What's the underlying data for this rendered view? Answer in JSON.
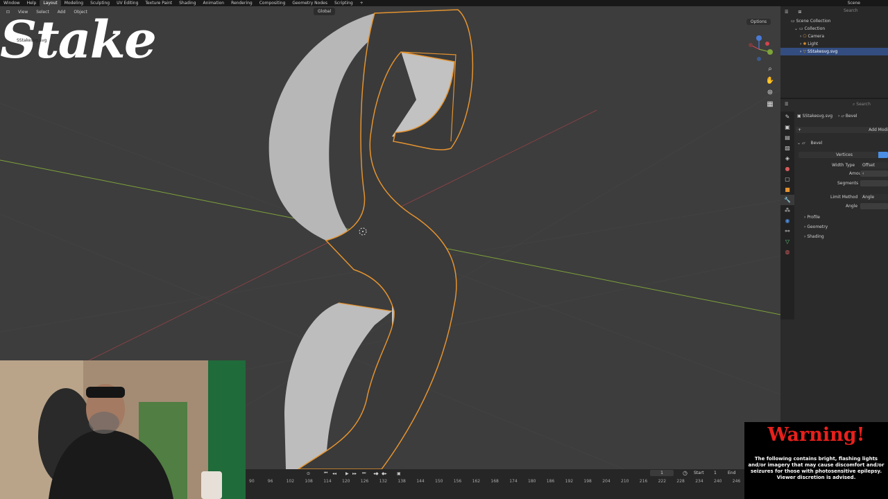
{
  "top_menu": {
    "items": [
      "Window",
      "Help",
      "Layout",
      "Modeling",
      "Sculpting",
      "UV Editing",
      "Texture Paint",
      "Shading",
      "Animation",
      "Rendering",
      "Compositing",
      "Geometry Nodes",
      "Scripting",
      "+"
    ],
    "active": "Layout",
    "scene": "Scene"
  },
  "viewport": {
    "menu": [
      "View",
      "Select",
      "Add",
      "Object"
    ],
    "orientation": "Global",
    "options_label": "Options",
    "logo_text": "Stake",
    "logo_file": "SStakesvg.svg",
    "accent_color": "#e5932f",
    "axis_x_color": "#d0444e",
    "axis_y_color": "#7ea33a"
  },
  "outliner": {
    "search_placeholder": "Search",
    "root": "Scene Collection",
    "collection": "Collection",
    "items": [
      {
        "name": "Camera",
        "icon": "camera-icon",
        "selected": false
      },
      {
        "name": "Light",
        "icon": "light-icon",
        "selected": false
      },
      {
        "name": "SStakesvg.svg",
        "icon": "object-icon",
        "selected": true
      }
    ]
  },
  "properties": {
    "search_placeholder": "Search",
    "object_name": "SStakesvg.svg",
    "modifier_name": "Bevel",
    "add_modifier_label": "Add Modi",
    "panel_title": "Bevel",
    "affect_label": "Vertices",
    "width_type_label": "Width Type",
    "width_type_value": "Offset",
    "amount_label": "Amount",
    "amount_value": "‹",
    "segments_label": "Segments",
    "limit_method_label": "Limit Method",
    "limit_method_value": "Angle",
    "angle_label": "Angle",
    "subpanels": [
      "Profile",
      "Geometry",
      "Shading"
    ]
  },
  "timeline": {
    "current_frame": "1",
    "start_label": "Start",
    "start_value": "1",
    "end_label": "End",
    "frame_ticks": [
      "90",
      "96",
      "102",
      "108",
      "114",
      "120",
      "126",
      "132",
      "138",
      "144",
      "150",
      "156",
      "162",
      "168",
      "174",
      "180",
      "186",
      "192",
      "198",
      "204",
      "210",
      "216",
      "222",
      "228",
      "234",
      "240",
      "246"
    ]
  },
  "warning": {
    "title": "Warning!",
    "body": "The following contains bright, flashing lights and/or imagery that may cause discomfort and/or seizures for those with photosensitive epilepsy. Viewer discretion is advised."
  }
}
